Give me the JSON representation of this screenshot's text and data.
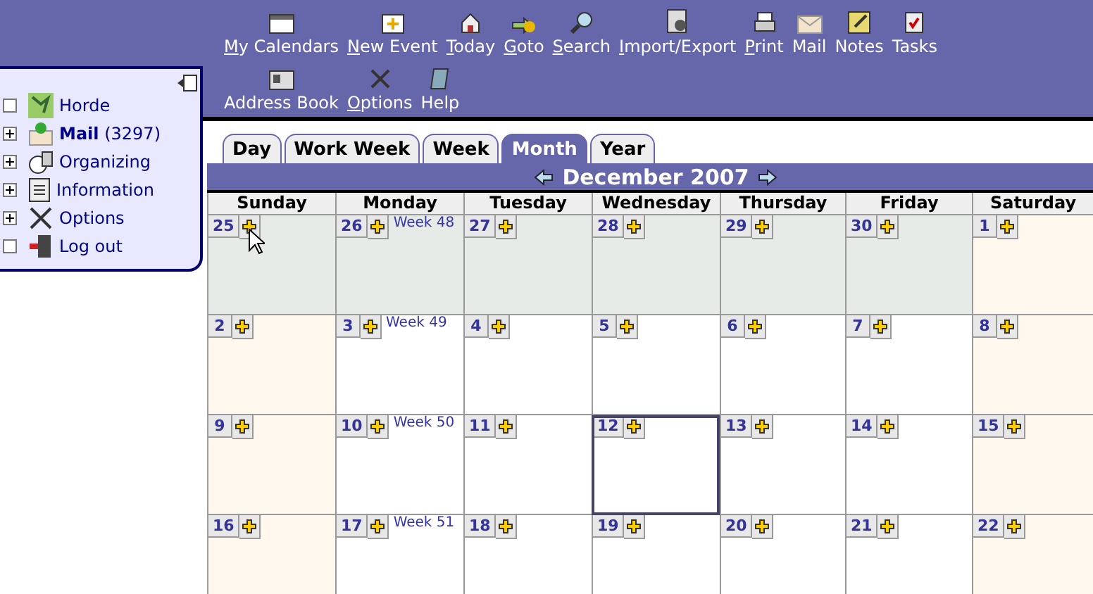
{
  "toolbar": [
    {
      "label": "My Calendars",
      "underlined": true
    },
    {
      "label": "New Event",
      "underlined": true
    },
    {
      "label": "Today",
      "underlined": true
    },
    {
      "label": "Goto",
      "underlined": true
    },
    {
      "label": "Search",
      "underlined": true
    },
    {
      "label": "Import/Export",
      "underlined": true
    },
    {
      "label": "Print",
      "underlined": true
    },
    {
      "label": "Mail",
      "underlined": false
    },
    {
      "label": "Notes",
      "underlined": false
    },
    {
      "label": "Tasks",
      "underlined": false
    },
    {
      "label": "Address Book",
      "underlined": false
    },
    {
      "label": "Options",
      "underlined": true
    },
    {
      "label": "Help",
      "underlined": false
    }
  ],
  "sidebar": {
    "items": [
      {
        "label": "Horde",
        "expandable": false
      },
      {
        "label": "Mail",
        "count": "(3297)",
        "expandable": true
      },
      {
        "label": "Organizing",
        "expandable": true
      },
      {
        "label": "Information",
        "expandable": true
      },
      {
        "label": "Options",
        "expandable": true
      },
      {
        "label": "Log out",
        "expandable": false
      }
    ]
  },
  "tabs": [
    {
      "label": "Day",
      "selected": false
    },
    {
      "label": "Work Week",
      "selected": false
    },
    {
      "label": "Week",
      "selected": false
    },
    {
      "label": "Month",
      "selected": true
    },
    {
      "label": "Year",
      "selected": false
    }
  ],
  "month_title": "December 2007",
  "weekdays": [
    "Sunday",
    "Monday",
    "Tuesday",
    "Wednesday",
    "Thursday",
    "Friday",
    "Saturday"
  ],
  "weeks": [
    {
      "label": "Week 48",
      "days": [
        {
          "day": "25",
          "kind": "other",
          "selected": false
        },
        {
          "day": "26",
          "kind": "other",
          "selected": false
        },
        {
          "day": "27",
          "kind": "other",
          "selected": false
        },
        {
          "day": "28",
          "kind": "other",
          "selected": false
        },
        {
          "day": "29",
          "kind": "other",
          "selected": false
        },
        {
          "day": "30",
          "kind": "other",
          "selected": false
        },
        {
          "day": "1",
          "kind": "weekend",
          "selected": false
        }
      ]
    },
    {
      "label": "Week 49",
      "days": [
        {
          "day": "2",
          "kind": "weekend",
          "selected": false
        },
        {
          "day": "3",
          "kind": "weekday",
          "selected": false
        },
        {
          "day": "4",
          "kind": "weekday",
          "selected": false
        },
        {
          "day": "5",
          "kind": "weekday",
          "selected": false
        },
        {
          "day": "6",
          "kind": "weekday",
          "selected": false
        },
        {
          "day": "7",
          "kind": "weekday",
          "selected": false
        },
        {
          "day": "8",
          "kind": "weekend",
          "selected": false
        }
      ]
    },
    {
      "label": "Week 50",
      "days": [
        {
          "day": "9",
          "kind": "weekend",
          "selected": false
        },
        {
          "day": "10",
          "kind": "weekday",
          "selected": false
        },
        {
          "day": "11",
          "kind": "weekday",
          "selected": false
        },
        {
          "day": "12",
          "kind": "weekday",
          "selected": true
        },
        {
          "day": "13",
          "kind": "weekday",
          "selected": false
        },
        {
          "day": "14",
          "kind": "weekday",
          "selected": false
        },
        {
          "day": "15",
          "kind": "weekend",
          "selected": false
        }
      ]
    },
    {
      "label": "Week 51",
      "days": [
        {
          "day": "16",
          "kind": "weekend",
          "selected": false
        },
        {
          "day": "17",
          "kind": "weekday",
          "selected": false
        },
        {
          "day": "18",
          "kind": "weekday",
          "selected": false
        },
        {
          "day": "19",
          "kind": "weekday",
          "selected": false
        },
        {
          "day": "20",
          "kind": "weekday",
          "selected": false
        },
        {
          "day": "21",
          "kind": "weekday",
          "selected": false
        },
        {
          "day": "22",
          "kind": "weekend",
          "selected": false
        }
      ]
    }
  ]
}
